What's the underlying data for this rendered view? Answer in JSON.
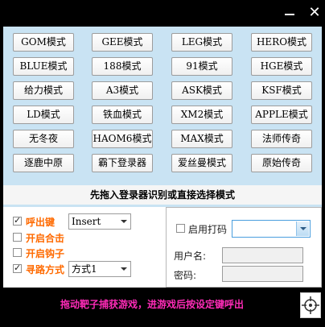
{
  "titlebar": {
    "minimize_icon": "minimize-icon",
    "close_symbol": "✕"
  },
  "modes": [
    [
      "GOM模式",
      "GEE模式",
      "LEG模式",
      "HERO模式"
    ],
    [
      "BLUE模式",
      "188模式",
      "91模式",
      "HGE模式"
    ],
    [
      "给力模式",
      "A3模式",
      "ASK模式",
      "KSF模式"
    ],
    [
      "LD模式",
      "铁血模式",
      "XM2模式",
      "APPLE模式"
    ],
    [
      "无冬夜",
      "HAOM6模式",
      "MAX模式",
      "法师传奇"
    ],
    [
      "逐鹿中原",
      "霸下登录器",
      "爱丝曼模式",
      "原始传奇"
    ]
  ],
  "hint": "先拖入登录器识别或直接选择模式",
  "options": {
    "hotkey": {
      "label": "呼出键",
      "checked": true,
      "value": "Insert"
    },
    "combine": {
      "label": "开启合击",
      "checked": false
    },
    "hook": {
      "label": "开启钩子",
      "checked": false
    },
    "pathfind": {
      "label": "寻路方式",
      "checked": true,
      "value": "方式1"
    }
  },
  "code_panel": {
    "enable_label": "启用打码",
    "enabled": false,
    "service_value": "",
    "username_label": "用户名:",
    "username_value": "",
    "password_label": "密码:",
    "password_value": ""
  },
  "status": {
    "text": "拖动靶子捕获游戏，进游戏后按设定键呼出",
    "target_icon": "crosshair-icon"
  },
  "colors": {
    "panel_bg": "#c9e3f3",
    "option_label": "#ff6a00",
    "status_text": "#ff2bb8"
  }
}
